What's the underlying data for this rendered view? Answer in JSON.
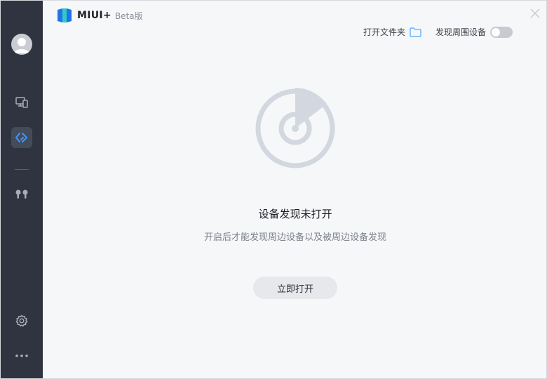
{
  "app": {
    "logo_text": "MIUI+",
    "beta_label": "Beta版",
    "accent_color": "#2b8cff"
  },
  "sidebar": {
    "items": [
      {
        "name": "avatar",
        "icon": "user-icon"
      },
      {
        "name": "devices",
        "icon": "devices-icon"
      },
      {
        "name": "xiaomi-share",
        "icon": "share-diamond-icon",
        "active": true
      },
      {
        "name": "earbuds",
        "icon": "earbuds-icon"
      },
      {
        "name": "settings",
        "icon": "gear-icon"
      },
      {
        "name": "more",
        "icon": "more-dots-icon"
      }
    ]
  },
  "header": {
    "open_folder_label": "打开文件夹",
    "discover_label": "发现周围设备",
    "discover_enabled": false
  },
  "main": {
    "title": "设备发现未打开",
    "subtitle": "开启后才能发现周边设备以及被周边设备发现",
    "open_button_label": "立即打开"
  }
}
